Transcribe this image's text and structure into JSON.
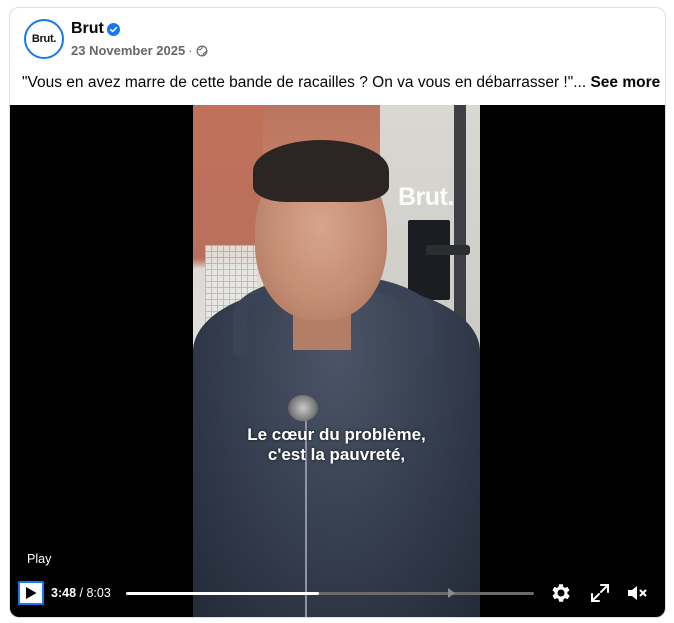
{
  "post": {
    "page_name": "Brut",
    "avatar_text": "Brut.",
    "date": "23 November 2025",
    "date_separator": "·",
    "caption": "\"Vous en avez marre de cette bande de racailles ? On va vous en débarrasser !\"...",
    "see_more": "See more"
  },
  "video": {
    "watermark": "Brut.",
    "subtitle_line1": "Le cœur du problème,",
    "subtitle_line2": "c'est la pauvreté,",
    "tooltip": "Play",
    "current_time": "3:48",
    "time_separator": " / ",
    "duration": "8:03",
    "progress_fraction": 0.473
  },
  "icons": {
    "verified": "verified-badge-icon",
    "privacy": "globe-icon",
    "play": "play-icon",
    "settings": "gear-icon",
    "fullscreen": "expand-icon",
    "volume": "muted-speaker-icon"
  },
  "colors": {
    "accent": "#1877f2",
    "secondary_text": "#65676b"
  }
}
